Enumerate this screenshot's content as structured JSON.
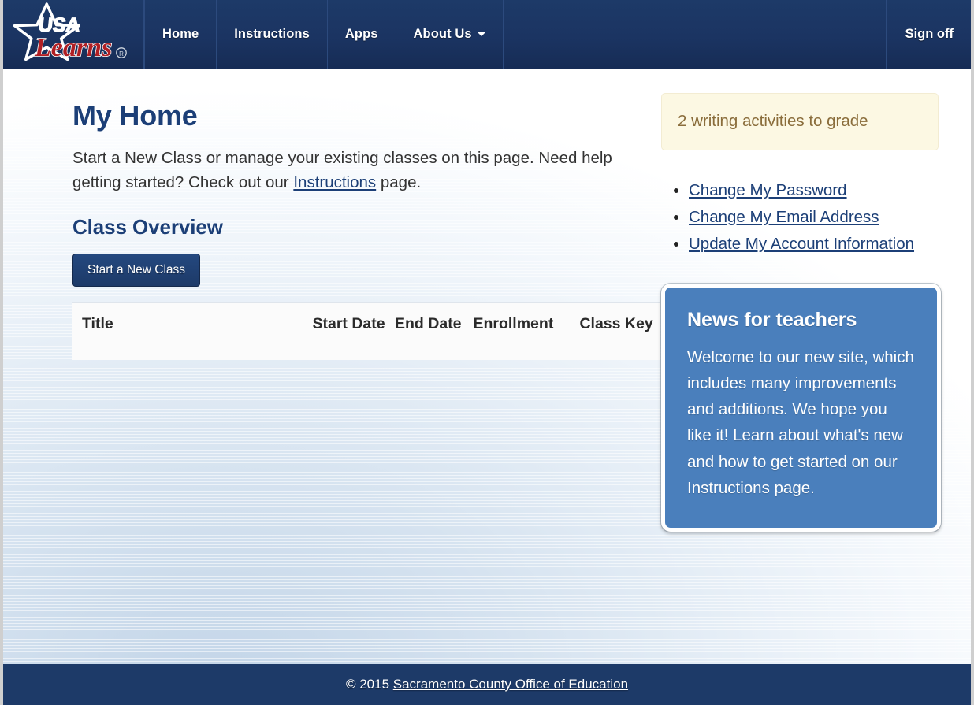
{
  "nav": {
    "brand": {
      "icon": "usa-learns-logo",
      "line1": "USA",
      "line2": "Learns",
      "trademark": "®"
    },
    "items": [
      {
        "label": "Home",
        "name": "nav-item-home",
        "caret": false
      },
      {
        "label": "Instructions",
        "name": "nav-item-instructions",
        "caret": false
      },
      {
        "label": "Apps",
        "name": "nav-item-apps",
        "caret": false
      },
      {
        "label": "About Us",
        "name": "nav-item-about-us",
        "caret": true
      }
    ],
    "sign_off_label": "Sign off"
  },
  "main": {
    "page_title": "My Home",
    "intro_before": "Start a New Class or manage your existing classes on this page. Need help getting started? Check out our ",
    "intro_link": "Instructions",
    "intro_after": " page.",
    "section_title": "Class Overview",
    "start_class_button": "Start a New Class",
    "table": {
      "columns": [
        "Title",
        "Start Date",
        "End Date",
        "Enrollment",
        "Class Key"
      ],
      "rows": []
    }
  },
  "sidebar": {
    "alert": {
      "text": "2 writing activities to grade",
      "count": 2
    },
    "links": [
      {
        "label": "Change My Password",
        "name": "link-change-my-password"
      },
      {
        "label": "Change My Email Address",
        "name": "link-change-my-email-address"
      },
      {
        "label": "Update My Account Information",
        "name": "link-update-my-account-information"
      }
    ],
    "news": {
      "title": "News for teachers",
      "body": "Welcome to our new site, which includes many improvements and additions. We hope you like it! Learn about what's new and how to get started on our Instructions page."
    }
  },
  "footer": {
    "copyright": "© 2015 ",
    "org_link": "Sacramento County Office of Education"
  },
  "colors": {
    "navy": "#1d3a68",
    "heading_blue": "#1c3f77",
    "logo_red": "#b01f24",
    "news_blue": "#4a7fbc",
    "alert_bg": "#fcf8e3",
    "alert_text": "#8a6d3b",
    "page_bg": "#e7eff7"
  }
}
